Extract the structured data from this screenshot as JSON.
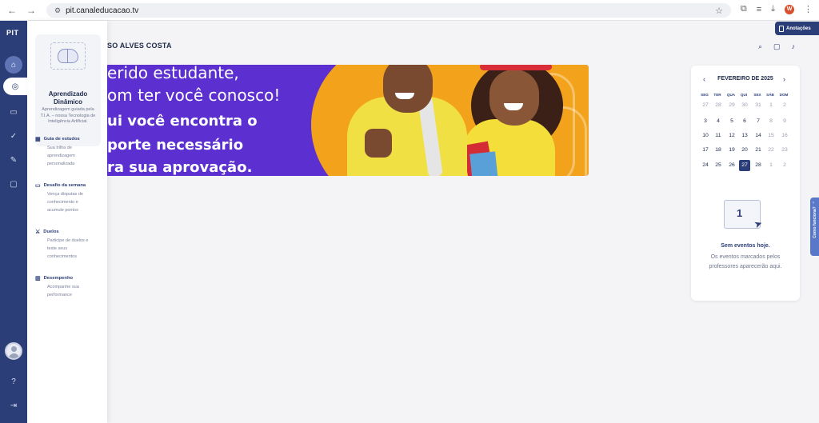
{
  "browser": {
    "url": "pit.canaleducacao.tv",
    "profile_initial": "W"
  },
  "rail": {
    "logo": "PIT"
  },
  "flyout": {
    "featured": {
      "title": "Aprendizado Dinâmico",
      "description": "Aprendizagem guiada pela T.I.A. – nossa Tecnologia de Inteligência Artificial."
    },
    "items": [
      {
        "label": "Guia de estudos",
        "description": "Sua trilha de aprendizagem personalizada"
      },
      {
        "label": "Desafio da semana",
        "description": "Vença disputas de conhecimento e acumule pontos"
      },
      {
        "label": "Duelos",
        "description": "Participe de duelos e teste seus conhecimentos"
      },
      {
        "label": "Desempenho",
        "description": "Acompanhe sua performance"
      }
    ]
  },
  "header": {
    "user_name": "SO ALVES COSTA",
    "notes_label": "Anotações"
  },
  "banner": {
    "line1": "erido estudante,",
    "line2": "om ter você conosco!",
    "line3": "ui você encontra o",
    "line4": "porte necessário",
    "line5": "ra sua aprovação."
  },
  "calendar": {
    "month_label": "FEVEREIRO DE 2025",
    "weekdays": [
      "SEG",
      "TER",
      "QUA",
      "QUI",
      "SEX",
      "SÁB",
      "DOM"
    ],
    "weeks": [
      [
        "27",
        "28",
        "29",
        "30",
        "31",
        "1",
        "2"
      ],
      [
        "3",
        "4",
        "5",
        "6",
        "7",
        "8",
        "9"
      ],
      [
        "10",
        "11",
        "12",
        "13",
        "14",
        "15",
        "16"
      ],
      [
        "17",
        "18",
        "19",
        "20",
        "21",
        "22",
        "23"
      ],
      [
        "24",
        "25",
        "26",
        "27",
        "28",
        "1",
        "2"
      ]
    ],
    "illustration_number": "1",
    "empty_title": "Sem eventos hoje.",
    "empty_description": "Os eventos marcados pelos professores aparecerão aqui."
  },
  "side_tab": {
    "label": "Como funciona?"
  }
}
